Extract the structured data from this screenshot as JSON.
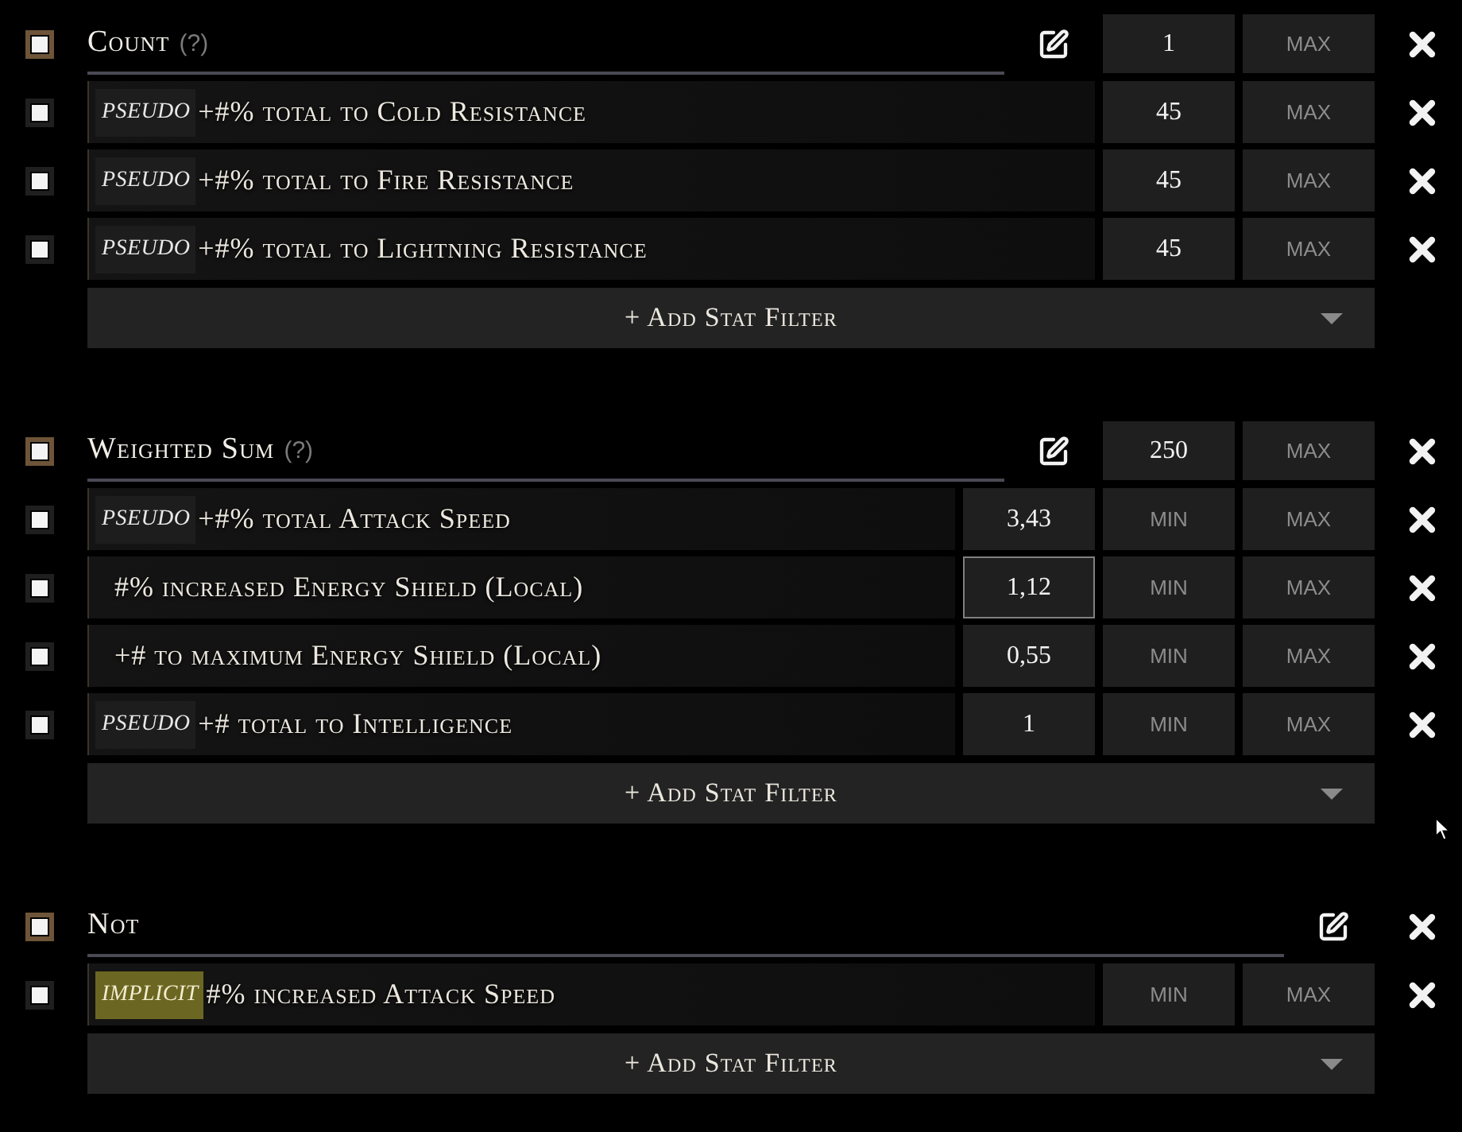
{
  "groups": [
    {
      "title": "Count",
      "help": "(?)",
      "checked": true,
      "min": {
        "value": "1"
      },
      "max": {
        "placeholder": "MAX"
      },
      "filters": [
        {
          "checked": true,
          "tag": {
            "kind": "pseudo",
            "label": "PSEUDO"
          },
          "text": "+#% total to Cold Resistance",
          "min": {
            "value": "45"
          },
          "max": {
            "placeholder": "MAX"
          }
        },
        {
          "checked": true,
          "tag": {
            "kind": "pseudo",
            "label": "PSEUDO"
          },
          "text": "+#% total to Fire Resistance",
          "min": {
            "value": "45"
          },
          "max": {
            "placeholder": "MAX"
          }
        },
        {
          "checked": true,
          "tag": {
            "kind": "pseudo",
            "label": "PSEUDO"
          },
          "text": "+#% total to Lightning Resistance",
          "min": {
            "value": "45"
          },
          "max": {
            "placeholder": "MAX"
          }
        }
      ],
      "add_filter": "+ Add Stat Filter"
    },
    {
      "title": "Weighted Sum",
      "help": "(?)",
      "checked": true,
      "min": {
        "value": "250"
      },
      "max": {
        "placeholder": "MAX"
      },
      "filters": [
        {
          "checked": true,
          "tag": {
            "kind": "pseudo",
            "label": "PSEUDO"
          },
          "text": "+#% total Attack Speed",
          "weight": {
            "value": "3,43",
            "focused": false
          },
          "min": {
            "placeholder": "MIN"
          },
          "max": {
            "placeholder": "MAX"
          }
        },
        {
          "checked": true,
          "text": "#% increased Energy Shield (Local)",
          "weight": {
            "value": "1,12",
            "focused": true
          },
          "min": {
            "placeholder": "MIN"
          },
          "max": {
            "placeholder": "MAX"
          }
        },
        {
          "checked": true,
          "text": "+# to maximum Energy Shield (Local)",
          "weight": {
            "value": "0,55",
            "focused": false
          },
          "min": {
            "placeholder": "MIN"
          },
          "max": {
            "placeholder": "MAX"
          }
        },
        {
          "checked": true,
          "tag": {
            "kind": "pseudo",
            "label": "PSEUDO"
          },
          "text": "+# total to Intelligence",
          "weight": {
            "value": "1",
            "focused": false
          },
          "min": {
            "placeholder": "MIN"
          },
          "max": {
            "placeholder": "MAX"
          }
        }
      ],
      "add_filter": "+ Add Stat Filter"
    },
    {
      "title": "Not",
      "checked": true,
      "filters": [
        {
          "checked": true,
          "tag": {
            "kind": "implicit",
            "label": "IMPLICIT"
          },
          "text": "#% increased Attack Speed",
          "min": {
            "placeholder": "MIN"
          },
          "max": {
            "placeholder": "MAX"
          }
        }
      ],
      "add_filter": "+ Add Stat Filter"
    }
  ]
}
